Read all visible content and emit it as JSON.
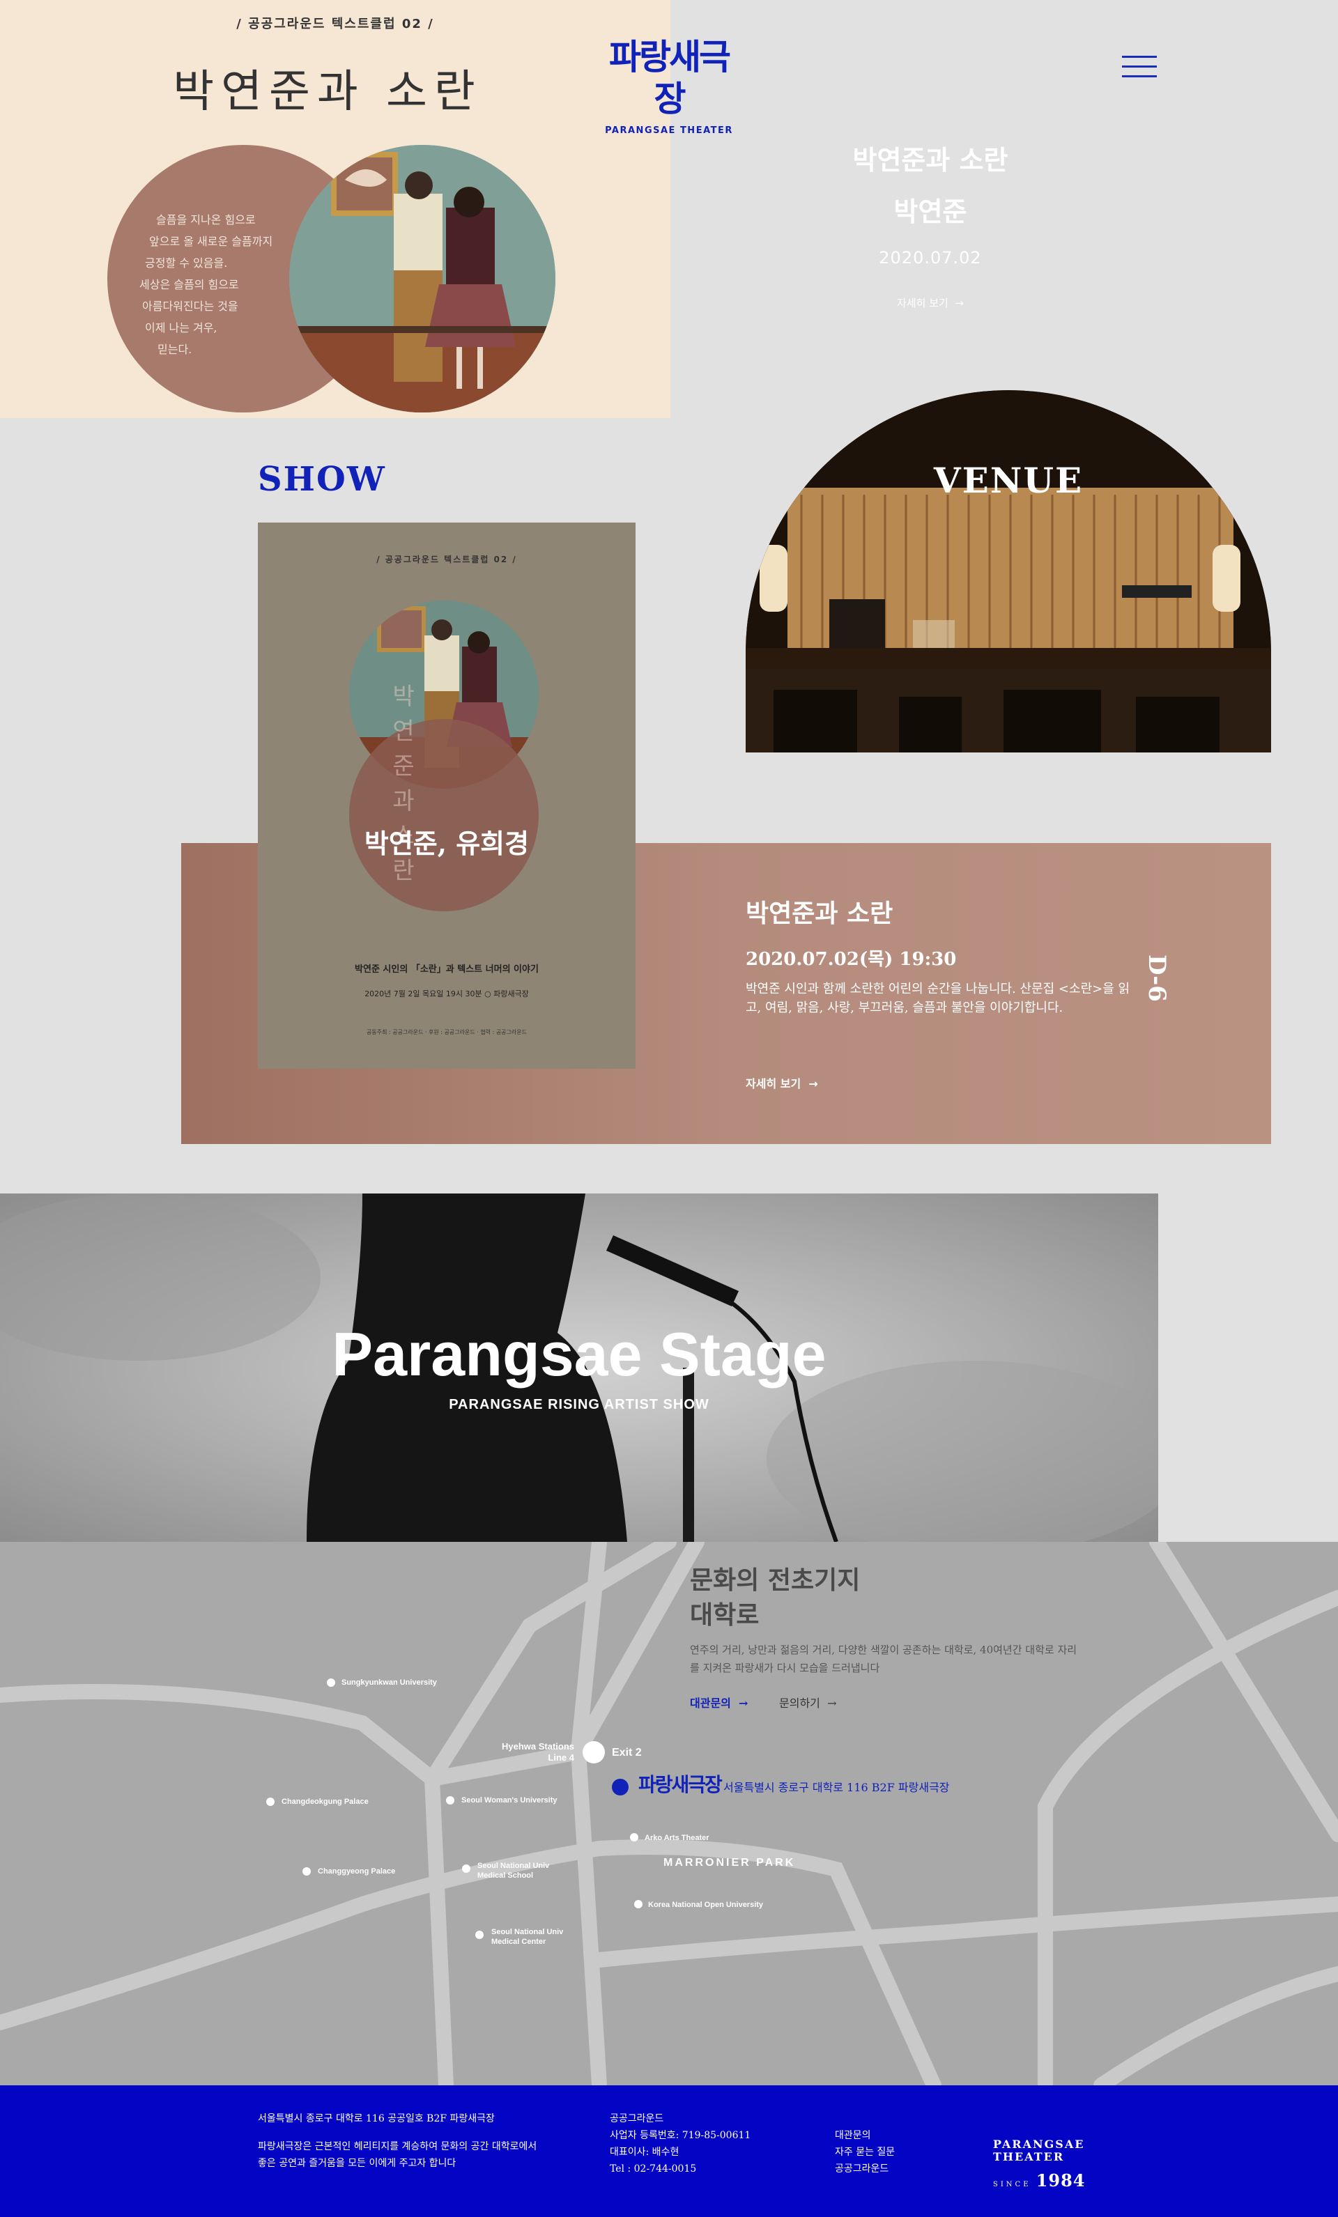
{
  "hero": {
    "club_line": "/ 공공그라운드 텍스트클럽 02 /",
    "title": "박연준과 소란",
    "poem": [
      "슬픔을 지나온 힘으로",
      "앞으로 올 새로운 슬픔까지",
      "긍정할 수 있음을.",
      "세상은 슬픔의 힘으로",
      "아름다워진다는 것을",
      "이제 나는 겨우,",
      "믿는다."
    ]
  },
  "logo": {
    "korean": "파랑새극장",
    "english": "PARANGSAE THEATER"
  },
  "menu_icon": "hamburger-icon",
  "hero_info": {
    "title": "박연준과 소란",
    "name": "박연준",
    "date": "2020.07.02",
    "more": "자세히 보기"
  },
  "show": {
    "heading": "SHOW",
    "title": "박연준과 소란",
    "date": "2020.07.02(목) 19:30",
    "desc": "박연준 시인과 함께 소란한 어린의 순간을 나눕니다. 산문집 <소란>을 읽고, 여림, 맑음, 사랑, 부끄러움, 슬픔과 불안을 이야기합니다.",
    "more": "자세히 보기",
    "dday": "D-6"
  },
  "poster": {
    "club_line": "/ 공공그라운드 텍스트클럽 02 /",
    "vertical_title": "박연준과 소란",
    "artists": "박연준, 유희경",
    "subtitle": "박연준 시인의 「소란」과 텍스트 너머의 이야기",
    "date_line": "2020년 7월 2일 목요일 19시 30분 ○ 파랑새극장",
    "sponsors": "공동주최 : 공공그라운드  ·  후원 : 공공그라운드  ·  협력 : 공공그라운드"
  },
  "venue": {
    "title": "VENUE"
  },
  "stage": {
    "title": "Parangsae Stage",
    "subtitle": "PARANGSAE RISING ARTIST SHOW"
  },
  "map": {
    "heading_line1": "문화의 전초기지",
    "heading_line2": "대학로",
    "desc": "연주의 거리, 낭만과 젊음의 거리, 다양한 색깔이 공존하는 대학로, 40여년간 대학로 자리를 지켜온 파랑새가 다시 모습을 드러냅니다",
    "link_rent": "대관문의",
    "link_contact": "문의하기",
    "address": "서울특별시 종로구 대학로 116 B2F 파랑새극장",
    "logo": "파랑새극장",
    "exit": "Exit 2",
    "station_line1": "Hyehwa Stations",
    "station_line2": "Line 4",
    "park": "MARRONIER PARK",
    "places": [
      "Sungkyunkwan University",
      "Changdeokgung Palace",
      "Seoul Woman's University",
      "Arko Arts Theater",
      "Changgyeong Palace",
      "Seoul National Univ Medical School",
      "Korea National Open University",
      "Seoul National Univ Medical Center"
    ]
  },
  "footer": {
    "address": "서울특별시 종로구 대학로 116 공공일호 B2F 파랑새극장",
    "about_line1": "파랑새극장은 근본적인 헤리티지를 계승하여 문화의 공간 대학로에서",
    "about_line2": "좋은 공연과 즐거움을 모든 이에게 주고자 합니다",
    "company": "공공그라운드",
    "biz_no": "사업자 등록번호: 719-85-00611",
    "ceo": "대표이사: 배수현",
    "tel": "Tel : 02-744-0015",
    "link1": "대관문의",
    "link2": "자주 묻는 질문",
    "link3": "공공그라운드",
    "brand_line1": "PARANGSAE",
    "brand_line2": "THEATER",
    "since_label": "SINCE",
    "since_year": "1984"
  }
}
